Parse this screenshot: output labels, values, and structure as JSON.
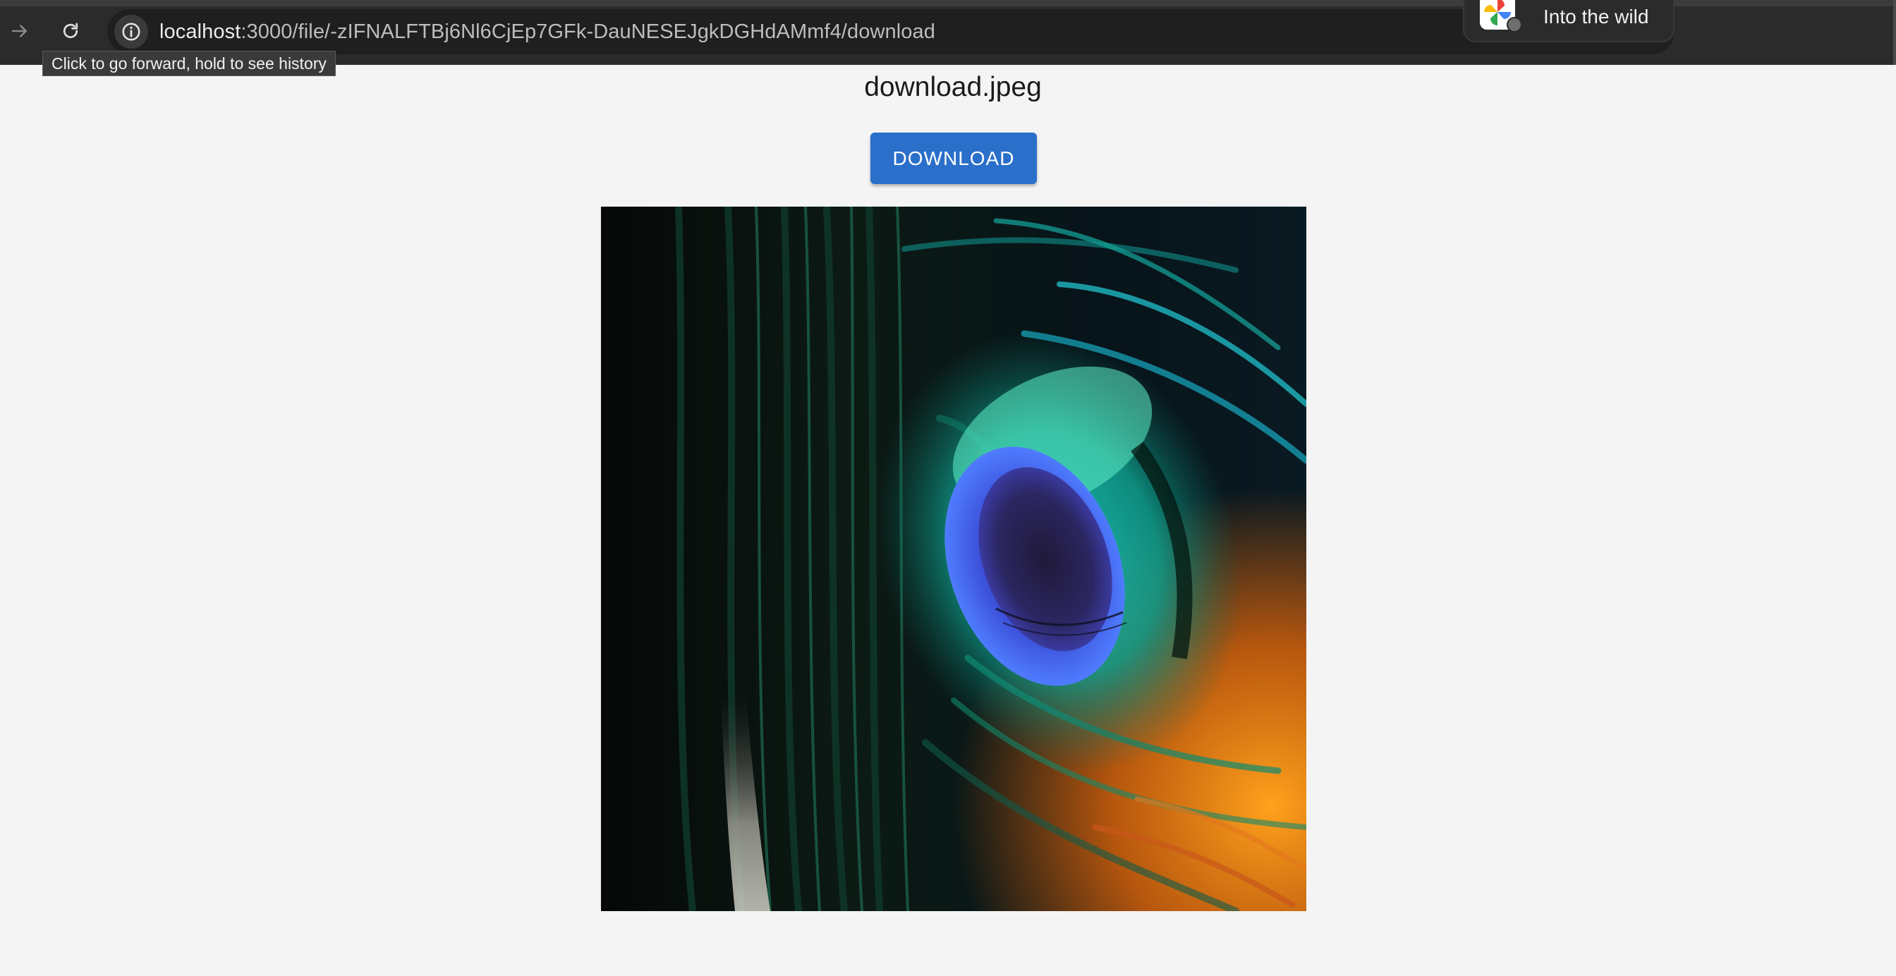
{
  "browser": {
    "url_host": "localhost",
    "url_rest": ":3000/file/-zIFNALFTBj6Nl6CjEp7GFk-DauNESEJgkDGHdAMmf4/download",
    "tooltip": "Click to go forward, hold to see history",
    "notification_text": "Into the wild",
    "icons": {
      "forward": "forward-arrow-icon",
      "reload": "reload-icon",
      "site_info": "info-icon",
      "notification": "google-photos-icon"
    }
  },
  "page": {
    "file_name": "download.jpeg",
    "download_label": "DOWNLOAD",
    "preview_subject": "peacock feather"
  },
  "colors": {
    "toolbar_bg": "#2b2b2b",
    "page_bg": "#f4f4f4",
    "button_bg": "#2a6fca",
    "button_text": "#ffffff"
  }
}
